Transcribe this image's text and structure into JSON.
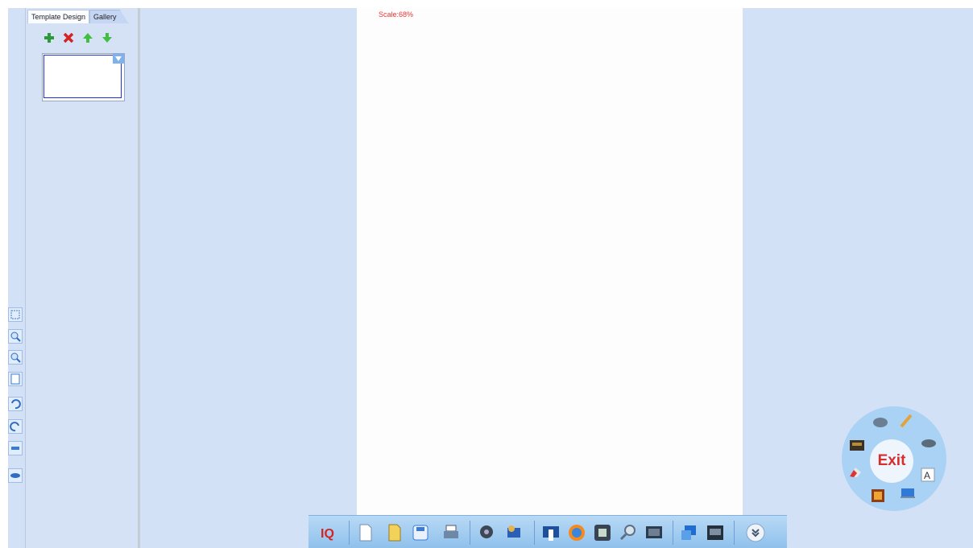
{
  "canvas": {
    "scale_label": "Scale:68%"
  },
  "side_panel": {
    "tabs": [
      {
        "label": "Template Design",
        "active": true
      },
      {
        "label": "Gallery",
        "active": false
      }
    ],
    "actions": [
      "add-page-icon",
      "delete-page-icon",
      "move-up-icon",
      "move-down-icon"
    ]
  },
  "mini_toolbar": [
    "fit-icon",
    "zoom-in-icon",
    "zoom-out-icon",
    "page-icon",
    "undo-icon",
    "redo-icon",
    "more-icon",
    "eraser-icon"
  ],
  "bottom_toolbar": [
    "iq-logo",
    "new-page-icon",
    "open-file-icon",
    "save-icon",
    "print-icon",
    "camera-icon",
    "screen-capture-icon",
    "reader-icon",
    "browser-icon",
    "recorder-icon",
    "magnifier-icon",
    "display-icon",
    "presentation-icon",
    "calculator-icon",
    "expand-icon"
  ],
  "radial_menu": {
    "exit_label": "Exit"
  },
  "colors": {
    "background": "#d3e1f7",
    "canvas": "#fdfdfd",
    "scale_text": "#f03434",
    "exit_text": "#d62d2d",
    "radial": "#a9d2f4"
  }
}
